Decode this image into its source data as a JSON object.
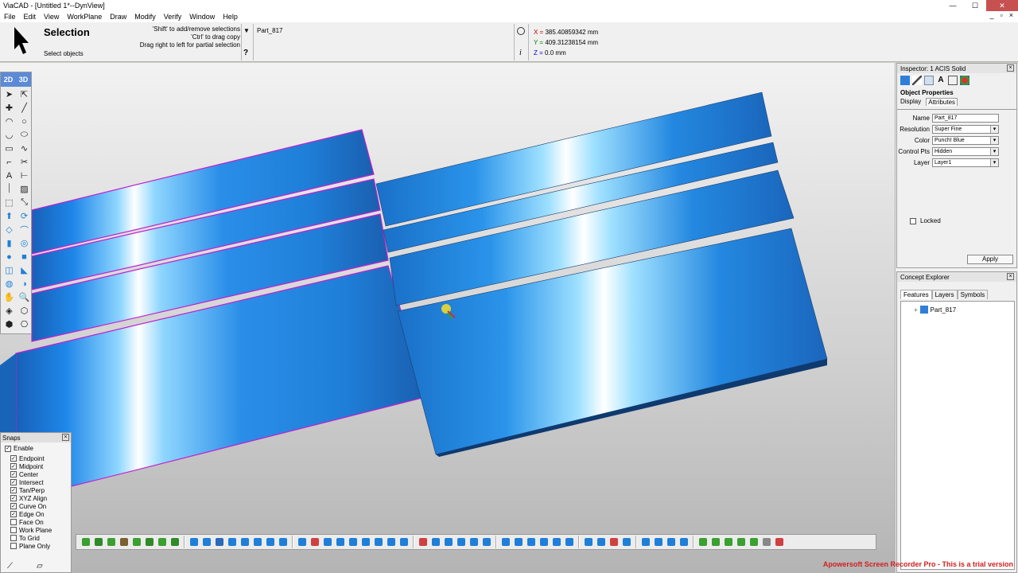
{
  "window": {
    "title": "ViaCAD - [Untitled 1*--DynView]",
    "minimize": "—",
    "maximize": "☐",
    "close": "✕"
  },
  "menu": [
    "File",
    "Edit",
    "View",
    "WorkPlane",
    "Draw",
    "Modify",
    "Verify",
    "Window",
    "Help"
  ],
  "mdi_controls": [
    "_",
    "▫",
    "×"
  ],
  "selection": {
    "title": "Selection",
    "subtitle": "Select objects",
    "hints": [
      "'Shift' to add/remove selections",
      "'Ctrl' to drag copy",
      "Drag right to left for partial selection"
    ],
    "part_name": "Part_817",
    "coords": {
      "x_label": "X =",
      "x": "385.40859342 mm",
      "y_label": "Y =",
      "y": "409.31238154 mm",
      "z_label": "Z =",
      "z": "0.0 mm"
    },
    "help_glyph": "?",
    "info_glyph": "i"
  },
  "tool_palette": {
    "tab_2d": "2D",
    "tab_3d": "3D",
    "tools": [
      "select-arrow-icon",
      "select-arrow-outline-icon",
      "point-icon",
      "line-icon",
      "arc-icon",
      "circle-icon",
      "arc-tangent-icon",
      "ellipse-icon",
      "rectangle-icon",
      "spline-icon",
      "fillet-icon",
      "trim-icon",
      "text-icon",
      "dimension-icon",
      "vertical-line-icon",
      "hatch-icon",
      "box-select-icon",
      "scale-icon",
      "extrude-icon",
      "revolve-icon",
      "loft-icon",
      "sweep-icon",
      "cylinder-icon",
      "boolean-icon",
      "sphere-icon",
      "box-icon",
      "shell-icon",
      "chamfer-icon",
      "light-icon",
      "render-icon",
      "pan-hand-icon",
      "zoom-icon",
      "view-iso-icon",
      "view-front-icon",
      "view-top-icon",
      "view-right-icon"
    ]
  },
  "snaps": {
    "title": "Snaps",
    "enable_label": "Enable",
    "items": [
      {
        "label": "Endpoint",
        "checked": true
      },
      {
        "label": "Midpoint",
        "checked": true
      },
      {
        "label": "Center",
        "checked": true
      },
      {
        "label": "Intersect",
        "checked": true
      },
      {
        "label": "Tan/Perp",
        "checked": true
      },
      {
        "label": "XYZ Align",
        "checked": true
      },
      {
        "label": "Curve On",
        "checked": true
      },
      {
        "label": "Edge On",
        "checked": true
      },
      {
        "label": "Face On",
        "checked": false
      },
      {
        "label": "Work Plane",
        "checked": false
      },
      {
        "label": "To Grid",
        "checked": false
      },
      {
        "label": "Plane Only",
        "checked": false
      }
    ]
  },
  "inspector": {
    "title": "Inspector: 1 ACIS Solid",
    "section_title": "Object Properties",
    "tabs": [
      "Display",
      "Attributes"
    ],
    "props": [
      {
        "label": "Name",
        "value": "Part_817",
        "dropdown": false
      },
      {
        "label": "Resolution",
        "value": "Super Fine",
        "dropdown": true
      },
      {
        "label": "Color",
        "value": "Punch! Blue",
        "dropdown": true
      },
      {
        "label": "Control Pts",
        "value": "Hidden",
        "dropdown": true
      },
      {
        "label": "Layer",
        "value": "Layer1",
        "dropdown": true
      }
    ],
    "locked_label": "Locked",
    "apply_label": "Apply"
  },
  "concept_explorer": {
    "title": "Concept Explorer",
    "tabs": [
      "Features",
      "Layers",
      "Symbols"
    ],
    "node": "Part_817",
    "node_expander": "+"
  },
  "colors": {
    "solid_blue": "#1f7fd8",
    "selection_outline": "#c020d0",
    "watermark": "#d02020"
  },
  "watermark": "Apowersoft Screen Recorder Pro - This is a trial version"
}
